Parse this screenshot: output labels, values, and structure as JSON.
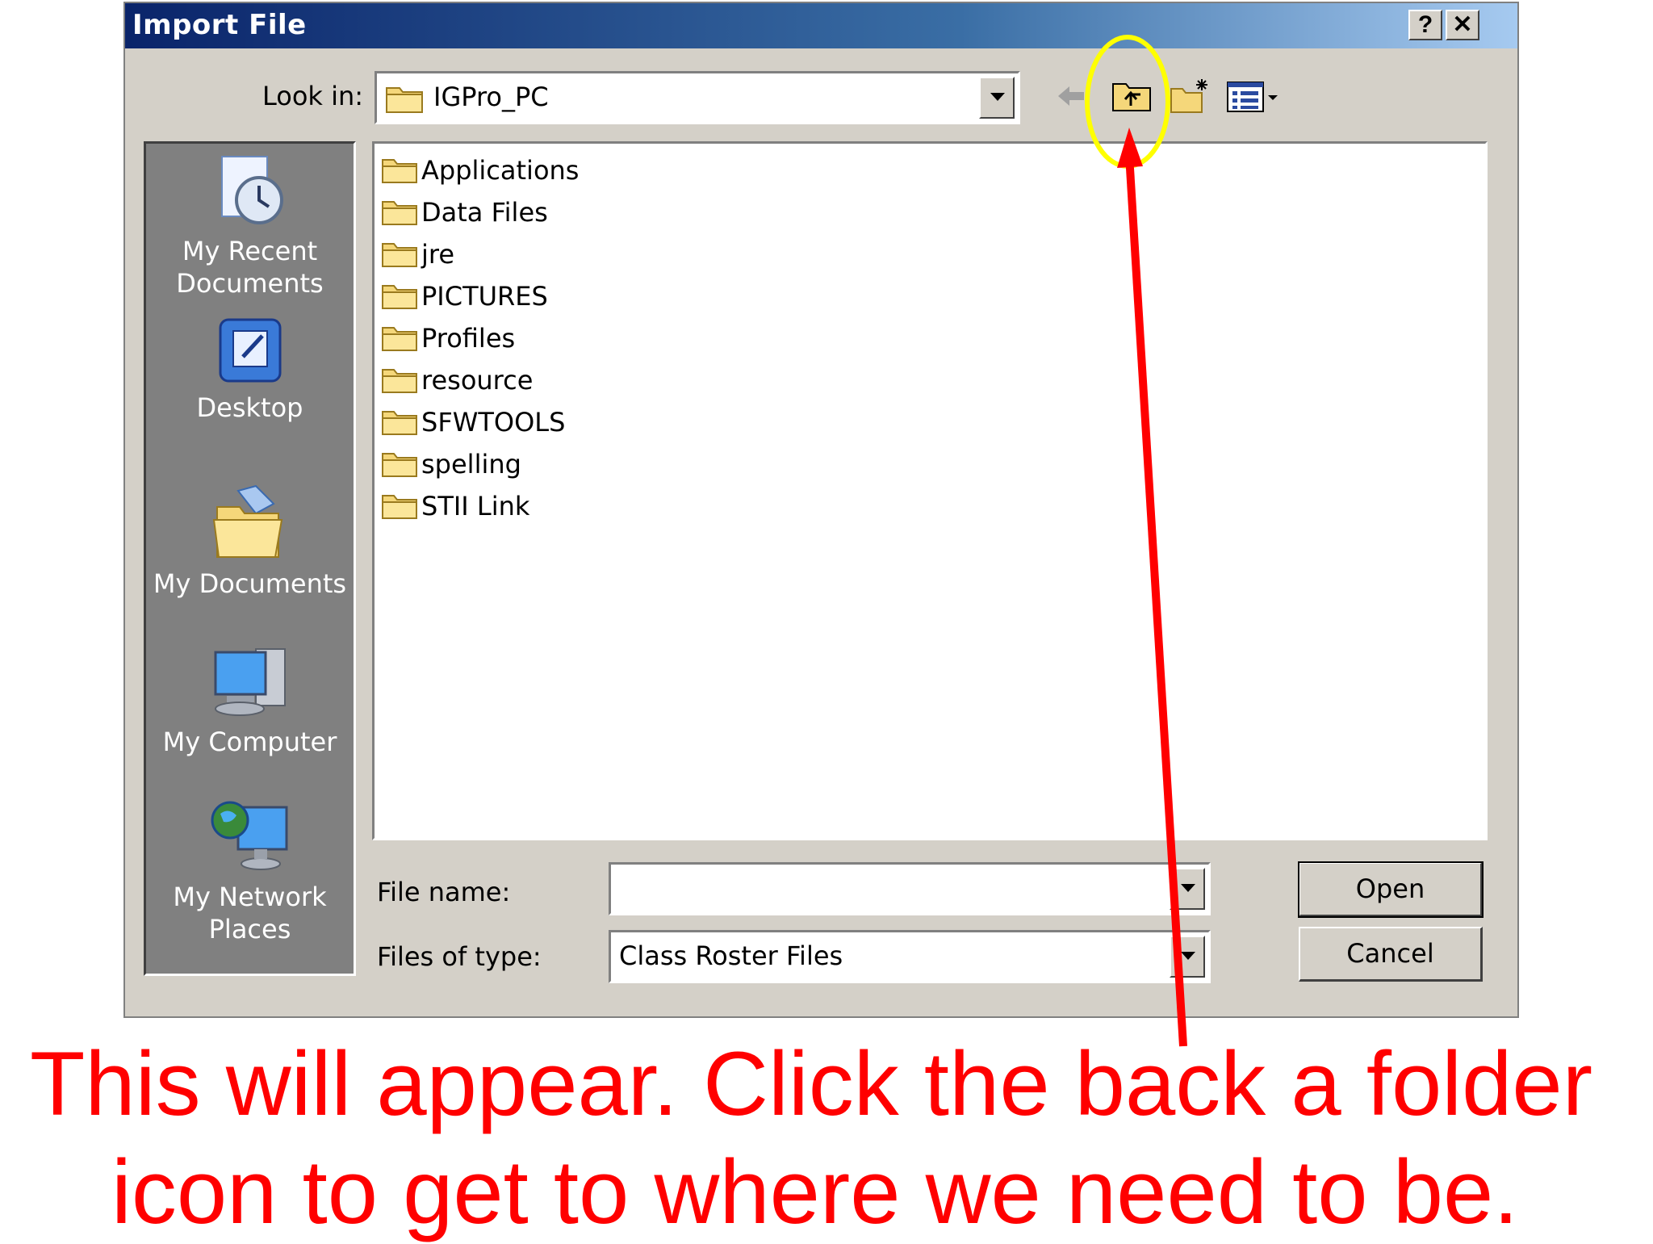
{
  "dialog": {
    "title": "Import File",
    "help_label": "?",
    "close_label": "✕"
  },
  "toolbar": {
    "look_in_label": "Look in:",
    "look_in_value": "IGPro_PC",
    "icons": [
      "back-arrow-icon",
      "up-one-level-icon",
      "new-folder-icon",
      "view-menu-icon"
    ]
  },
  "places": [
    {
      "label_line1": "My Recent",
      "label_line2": "Documents",
      "icon": "recent-documents-icon"
    },
    {
      "label_line1": "Desktop",
      "label_line2": "",
      "icon": "desktop-icon"
    },
    {
      "label_line1": "My Documents",
      "label_line2": "",
      "icon": "my-documents-icon"
    },
    {
      "label_line1": "My Computer",
      "label_line2": "",
      "icon": "my-computer-icon"
    },
    {
      "label_line1": "My Network",
      "label_line2": "Places",
      "icon": "network-places-icon"
    }
  ],
  "files": [
    "Applications",
    "Data Files",
    "jre",
    "PICTURES",
    "Profiles",
    "resource",
    "SFWTOOLS",
    "spelling",
    "STII Link"
  ],
  "form": {
    "file_name_label": "File name:",
    "file_name_value": "",
    "file_type_label": "Files of type:",
    "file_type_value": "Class Roster Files",
    "open_label": "Open",
    "cancel_label": "Cancel"
  },
  "annotation": {
    "line1": "This will appear. Click the back a folder",
    "line2": "icon to get to where we need to be.",
    "color": "#ff0000",
    "highlight_color": "#ffff00"
  }
}
